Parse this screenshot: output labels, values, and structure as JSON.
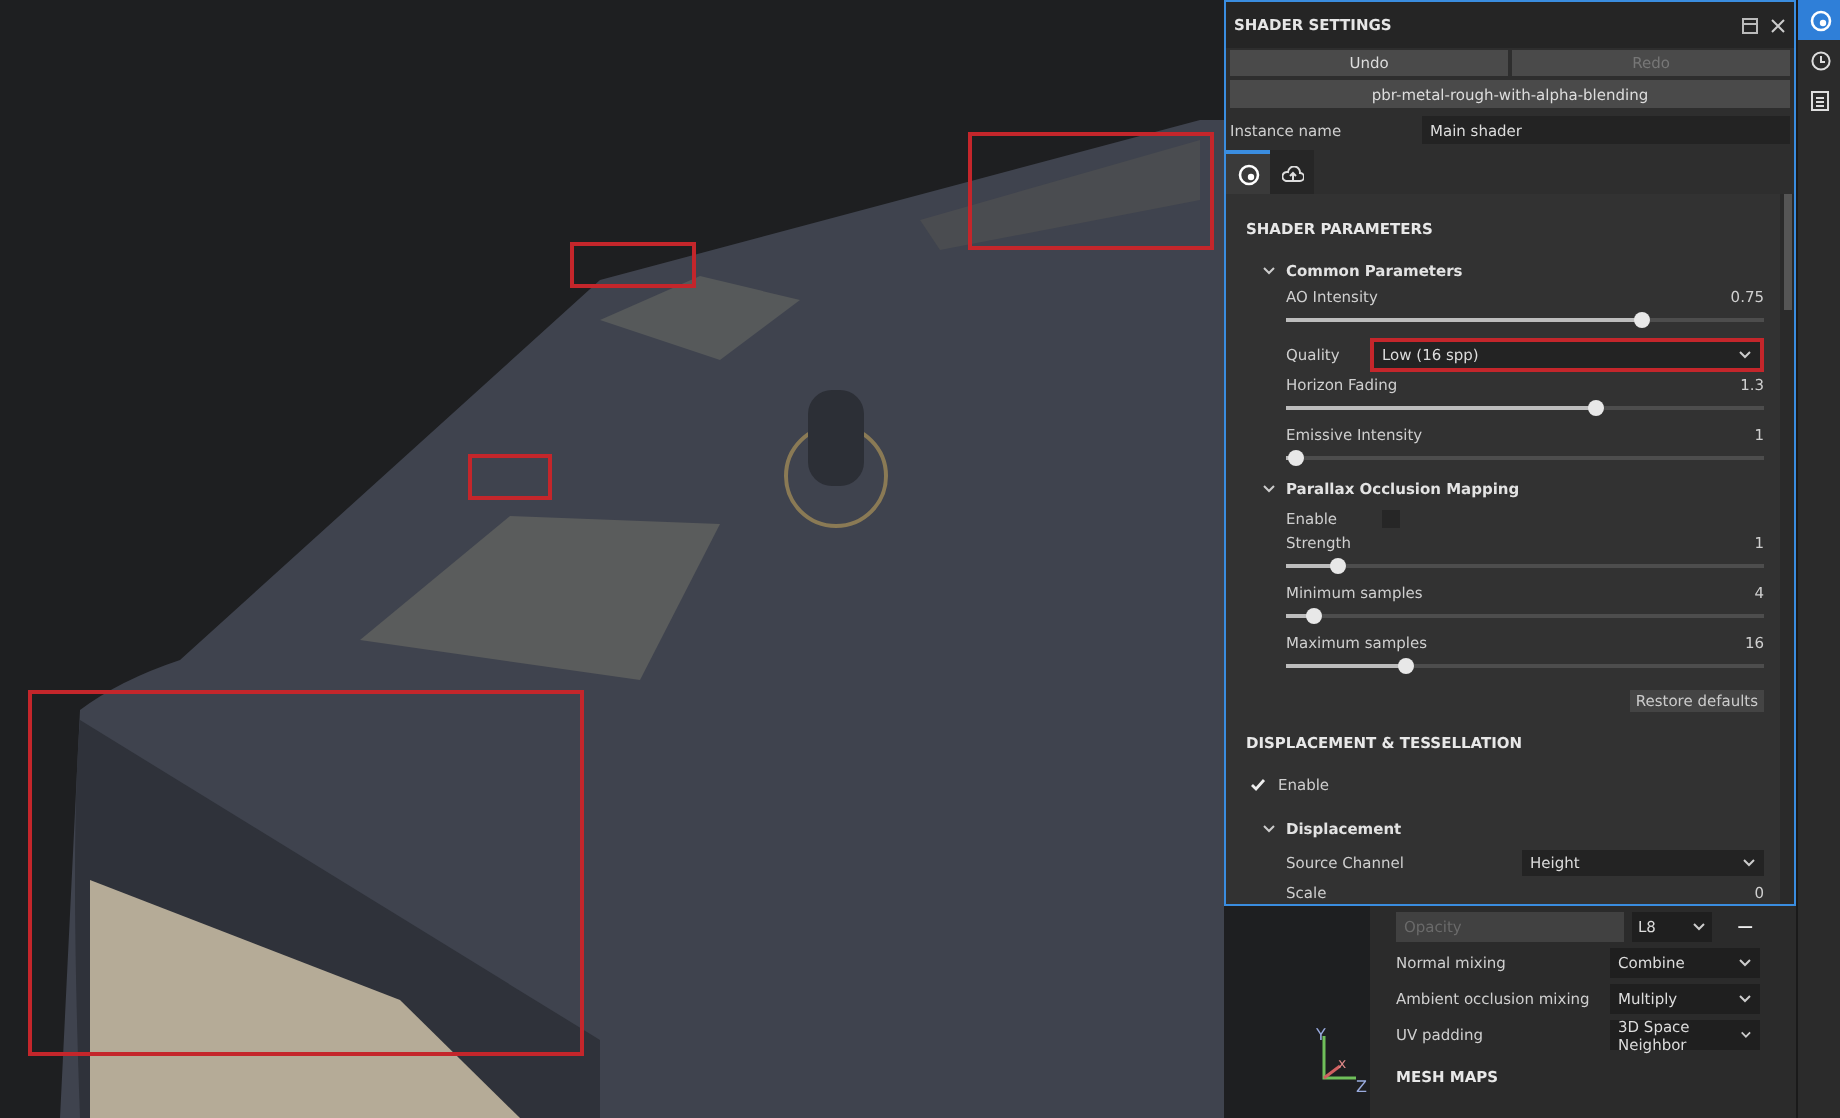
{
  "viewport": {
    "gizmo": {
      "y": "Y",
      "x": "x",
      "z": "Z"
    }
  },
  "side_strip": {
    "items": [
      {
        "kind": "shader",
        "selected": true
      },
      {
        "kind": "history",
        "selected": false
      },
      {
        "kind": "list",
        "selected": false
      }
    ]
  },
  "shader_panel": {
    "title": "SHADER SETTINGS",
    "undo": {
      "label": "Undo",
      "disabled": false
    },
    "redo": {
      "label": "Redo",
      "disabled": true
    },
    "shader_button": "pbr-metal-rough-with-alpha-blending",
    "instance_name": {
      "label": "Instance name",
      "value": "Main shader"
    },
    "tabs": [
      {
        "kind": "shader",
        "selected": true
      },
      {
        "kind": "export",
        "selected": false
      }
    ],
    "sections": [
      {
        "title": "SHADER PARAMETERS",
        "rows": [
          {
            "kind": "group",
            "label": "Common Parameters",
            "expanded": true
          },
          {
            "kind": "slider",
            "label": "AO Intensity",
            "reading": "0.75",
            "level": 0.745
          },
          {
            "kind": "select",
            "label": "Quality",
            "value": "Low (16 spp)",
            "highlighted": true
          },
          {
            "kind": "slider",
            "label": "Horizon Fading",
            "reading": "1.3",
            "level": 0.65
          },
          {
            "kind": "slider",
            "label": "Emissive Intensity",
            "reading": "1",
            "level": 0.02
          },
          {
            "kind": "group",
            "label": "Parallax Occlusion Mapping",
            "expanded": true
          },
          {
            "kind": "checkbox",
            "label": "Enable",
            "checked": false
          },
          {
            "kind": "slider",
            "label": "Strength",
            "reading": "1",
            "level": 0.11
          },
          {
            "kind": "slider",
            "label": "Minimum samples",
            "reading": "4",
            "level": 0.06
          },
          {
            "kind": "slider",
            "label": "Maximum samples",
            "reading": "16",
            "level": 0.25
          },
          {
            "kind": "button",
            "label": "Restore defaults"
          }
        ]
      },
      {
        "title": "DISPLACEMENT & TESSELLATION",
        "rows": [
          {
            "kind": "check",
            "label": "Enable",
            "checked": true
          },
          {
            "kind": "group",
            "label": "Displacement",
            "expanded": true
          },
          {
            "kind": "select",
            "label": "Source Channel",
            "value": "Height",
            "highlighted": false
          },
          {
            "kind": "value",
            "label": "Scale",
            "reading": "0"
          }
        ]
      }
    ]
  },
  "export_panel": {
    "opacity": {
      "placeholder": "Opacity",
      "disabled": true
    },
    "format": "L8",
    "remove": "−",
    "rows": [
      {
        "label": "Normal mixing",
        "value": "Combine"
      },
      {
        "label": "Ambient occlusion mixing",
        "value": "Multiply"
      },
      {
        "label": "UV padding",
        "value": "3D Space Neighbor"
      }
    ],
    "heading": "MESH MAPS"
  }
}
